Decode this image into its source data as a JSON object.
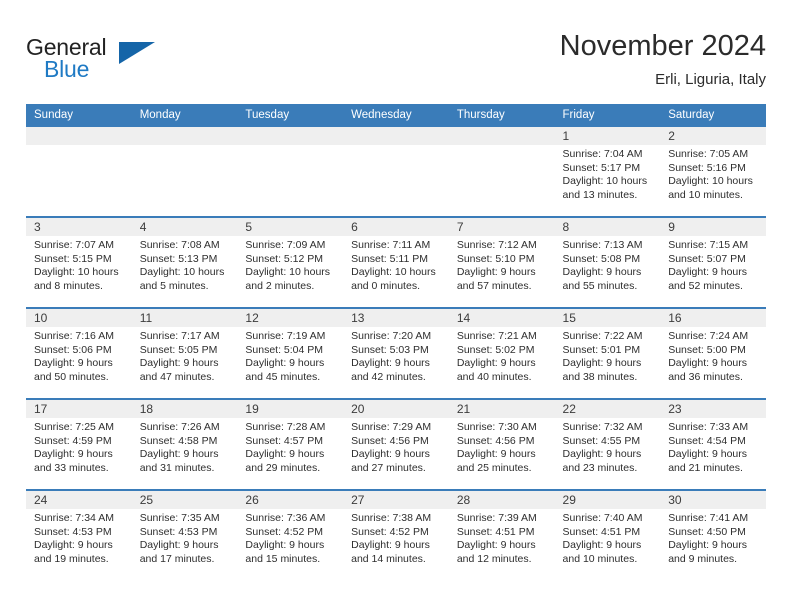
{
  "brand": {
    "name_part1": "General",
    "name_part2": "Blue",
    "accent_color": "#1f7ac4",
    "triangle_color": "#1565a8"
  },
  "header": {
    "month_title": "November 2024",
    "location": "Erli, Liguria, Italy"
  },
  "theme": {
    "header_bar_color": "#3a7cb9",
    "date_band_color": "#efefef",
    "row_border_color": "#3a7cb9"
  },
  "weekdays": [
    "Sunday",
    "Monday",
    "Tuesday",
    "Wednesday",
    "Thursday",
    "Friday",
    "Saturday"
  ],
  "labels": {
    "sunrise_prefix": "Sunrise:",
    "sunset_prefix": "Sunset:",
    "daylight_prefix": "Daylight:"
  },
  "weeks": [
    [
      {
        "day": "",
        "empty": true
      },
      {
        "day": "",
        "empty": true
      },
      {
        "day": "",
        "empty": true
      },
      {
        "day": "",
        "empty": true
      },
      {
        "day": "",
        "empty": true
      },
      {
        "day": "1",
        "sunrise": "Sunrise: 7:04 AM",
        "sunset": "Sunset: 5:17 PM",
        "daylight_line1": "Daylight: 10 hours",
        "daylight_line2": "and 13 minutes."
      },
      {
        "day": "2",
        "sunrise": "Sunrise: 7:05 AM",
        "sunset": "Sunset: 5:16 PM",
        "daylight_line1": "Daylight: 10 hours",
        "daylight_line2": "and 10 minutes."
      }
    ],
    [
      {
        "day": "3",
        "sunrise": "Sunrise: 7:07 AM",
        "sunset": "Sunset: 5:15 PM",
        "daylight_line1": "Daylight: 10 hours",
        "daylight_line2": "and 8 minutes."
      },
      {
        "day": "4",
        "sunrise": "Sunrise: 7:08 AM",
        "sunset": "Sunset: 5:13 PM",
        "daylight_line1": "Daylight: 10 hours",
        "daylight_line2": "and 5 minutes."
      },
      {
        "day": "5",
        "sunrise": "Sunrise: 7:09 AM",
        "sunset": "Sunset: 5:12 PM",
        "daylight_line1": "Daylight: 10 hours",
        "daylight_line2": "and 2 minutes."
      },
      {
        "day": "6",
        "sunrise": "Sunrise: 7:11 AM",
        "sunset": "Sunset: 5:11 PM",
        "daylight_line1": "Daylight: 10 hours",
        "daylight_line2": "and 0 minutes."
      },
      {
        "day": "7",
        "sunrise": "Sunrise: 7:12 AM",
        "sunset": "Sunset: 5:10 PM",
        "daylight_line1": "Daylight: 9 hours",
        "daylight_line2": "and 57 minutes."
      },
      {
        "day": "8",
        "sunrise": "Sunrise: 7:13 AM",
        "sunset": "Sunset: 5:08 PM",
        "daylight_line1": "Daylight: 9 hours",
        "daylight_line2": "and 55 minutes."
      },
      {
        "day": "9",
        "sunrise": "Sunrise: 7:15 AM",
        "sunset": "Sunset: 5:07 PM",
        "daylight_line1": "Daylight: 9 hours",
        "daylight_line2": "and 52 minutes."
      }
    ],
    [
      {
        "day": "10",
        "sunrise": "Sunrise: 7:16 AM",
        "sunset": "Sunset: 5:06 PM",
        "daylight_line1": "Daylight: 9 hours",
        "daylight_line2": "and 50 minutes."
      },
      {
        "day": "11",
        "sunrise": "Sunrise: 7:17 AM",
        "sunset": "Sunset: 5:05 PM",
        "daylight_line1": "Daylight: 9 hours",
        "daylight_line2": "and 47 minutes."
      },
      {
        "day": "12",
        "sunrise": "Sunrise: 7:19 AM",
        "sunset": "Sunset: 5:04 PM",
        "daylight_line1": "Daylight: 9 hours",
        "daylight_line2": "and 45 minutes."
      },
      {
        "day": "13",
        "sunrise": "Sunrise: 7:20 AM",
        "sunset": "Sunset: 5:03 PM",
        "daylight_line1": "Daylight: 9 hours",
        "daylight_line2": "and 42 minutes."
      },
      {
        "day": "14",
        "sunrise": "Sunrise: 7:21 AM",
        "sunset": "Sunset: 5:02 PM",
        "daylight_line1": "Daylight: 9 hours",
        "daylight_line2": "and 40 minutes."
      },
      {
        "day": "15",
        "sunrise": "Sunrise: 7:22 AM",
        "sunset": "Sunset: 5:01 PM",
        "daylight_line1": "Daylight: 9 hours",
        "daylight_line2": "and 38 minutes."
      },
      {
        "day": "16",
        "sunrise": "Sunrise: 7:24 AM",
        "sunset": "Sunset: 5:00 PM",
        "daylight_line1": "Daylight: 9 hours",
        "daylight_line2": "and 36 minutes."
      }
    ],
    [
      {
        "day": "17",
        "sunrise": "Sunrise: 7:25 AM",
        "sunset": "Sunset: 4:59 PM",
        "daylight_line1": "Daylight: 9 hours",
        "daylight_line2": "and 33 minutes."
      },
      {
        "day": "18",
        "sunrise": "Sunrise: 7:26 AM",
        "sunset": "Sunset: 4:58 PM",
        "daylight_line1": "Daylight: 9 hours",
        "daylight_line2": "and 31 minutes."
      },
      {
        "day": "19",
        "sunrise": "Sunrise: 7:28 AM",
        "sunset": "Sunset: 4:57 PM",
        "daylight_line1": "Daylight: 9 hours",
        "daylight_line2": "and 29 minutes."
      },
      {
        "day": "20",
        "sunrise": "Sunrise: 7:29 AM",
        "sunset": "Sunset: 4:56 PM",
        "daylight_line1": "Daylight: 9 hours",
        "daylight_line2": "and 27 minutes."
      },
      {
        "day": "21",
        "sunrise": "Sunrise: 7:30 AM",
        "sunset": "Sunset: 4:56 PM",
        "daylight_line1": "Daylight: 9 hours",
        "daylight_line2": "and 25 minutes."
      },
      {
        "day": "22",
        "sunrise": "Sunrise: 7:32 AM",
        "sunset": "Sunset: 4:55 PM",
        "daylight_line1": "Daylight: 9 hours",
        "daylight_line2": "and 23 minutes."
      },
      {
        "day": "23",
        "sunrise": "Sunrise: 7:33 AM",
        "sunset": "Sunset: 4:54 PM",
        "daylight_line1": "Daylight: 9 hours",
        "daylight_line2": "and 21 minutes."
      }
    ],
    [
      {
        "day": "24",
        "sunrise": "Sunrise: 7:34 AM",
        "sunset": "Sunset: 4:53 PM",
        "daylight_line1": "Daylight: 9 hours",
        "daylight_line2": "and 19 minutes."
      },
      {
        "day": "25",
        "sunrise": "Sunrise: 7:35 AM",
        "sunset": "Sunset: 4:53 PM",
        "daylight_line1": "Daylight: 9 hours",
        "daylight_line2": "and 17 minutes."
      },
      {
        "day": "26",
        "sunrise": "Sunrise: 7:36 AM",
        "sunset": "Sunset: 4:52 PM",
        "daylight_line1": "Daylight: 9 hours",
        "daylight_line2": "and 15 minutes."
      },
      {
        "day": "27",
        "sunrise": "Sunrise: 7:38 AM",
        "sunset": "Sunset: 4:52 PM",
        "daylight_line1": "Daylight: 9 hours",
        "daylight_line2": "and 14 minutes."
      },
      {
        "day": "28",
        "sunrise": "Sunrise: 7:39 AM",
        "sunset": "Sunset: 4:51 PM",
        "daylight_line1": "Daylight: 9 hours",
        "daylight_line2": "and 12 minutes."
      },
      {
        "day": "29",
        "sunrise": "Sunrise: 7:40 AM",
        "sunset": "Sunset: 4:51 PM",
        "daylight_line1": "Daylight: 9 hours",
        "daylight_line2": "and 10 minutes."
      },
      {
        "day": "30",
        "sunrise": "Sunrise: 7:41 AM",
        "sunset": "Sunset: 4:50 PM",
        "daylight_line1": "Daylight: 9 hours",
        "daylight_line2": "and 9 minutes."
      }
    ]
  ]
}
